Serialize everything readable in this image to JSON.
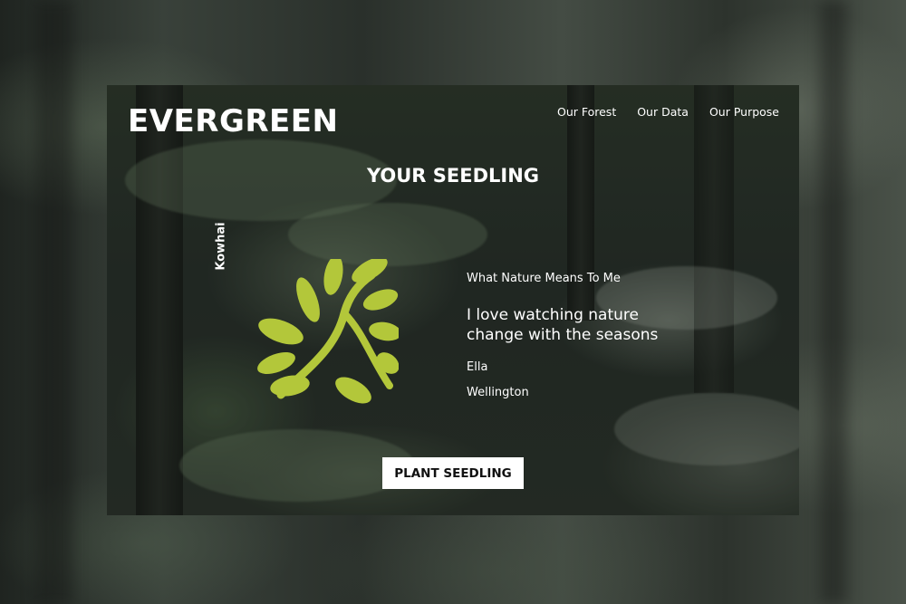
{
  "brand": {
    "name": "EVERGREEN"
  },
  "nav": {
    "items": [
      {
        "label": "Our Forest"
      },
      {
        "label": "Our Data"
      },
      {
        "label": "Our Purpose"
      }
    ]
  },
  "main": {
    "title": "YOUR SEEDLING",
    "species": "Kowhai",
    "leaf_icon": "kowhai-leaf-icon",
    "prompt_label": "What Nature Means To Me",
    "quote": "I love watching nature change with the seasons",
    "author_name": "Ella",
    "author_location": "Wellington",
    "plant_button_label": "PLANT SEEDLING"
  },
  "colors": {
    "leaf": "#b3c73a",
    "text": "#ffffff",
    "button_bg": "#ffffff",
    "button_text": "#111111"
  }
}
